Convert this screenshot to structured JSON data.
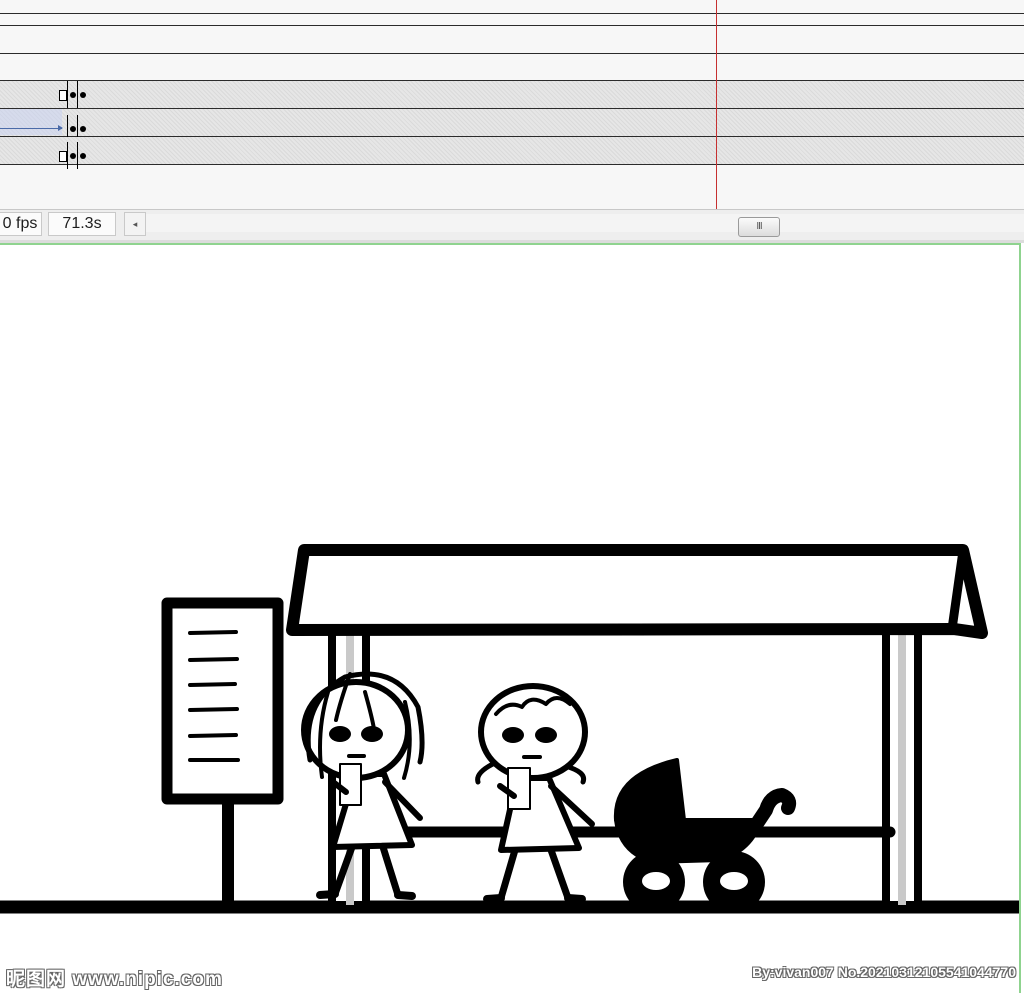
{
  "timeline": {
    "fps_label": "0 fps",
    "elapsed_time": "71.3s",
    "scroll_left_glyph": "◂",
    "scroll_thumb_grip": "III"
  },
  "stage": {
    "background_color": "#ffffff",
    "border_color": "#8fd38f"
  },
  "watermark": {
    "left_text": "昵图网 www.nipic.com",
    "right_text": "By:vivan007 No.20210312105541044770"
  }
}
